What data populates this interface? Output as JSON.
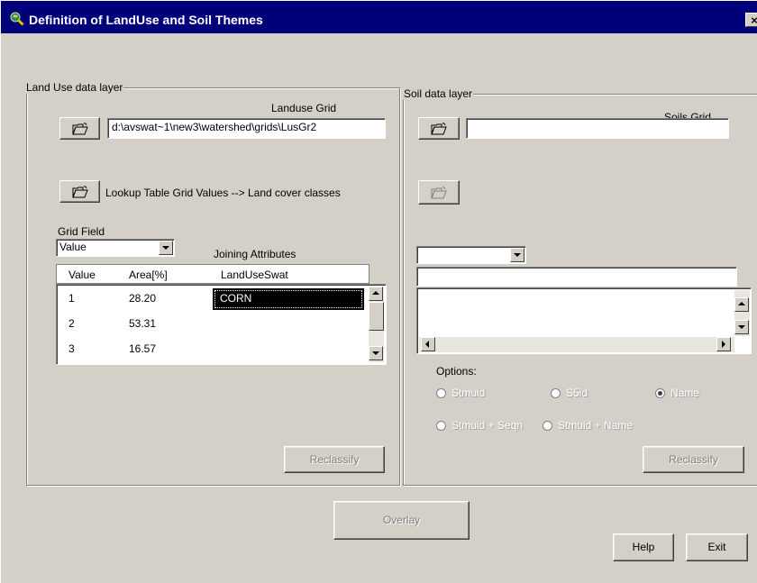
{
  "window": {
    "title": "Definition of LandUse and Soil Themes",
    "close_glyph": "×",
    "title_icon": "globe-magnifier-icon"
  },
  "landuse": {
    "group_label": "Land Use data layer",
    "grid_label": "Landuse Grid",
    "grid_path": "d:\\avswat~1\\new3\\watershed\\grids\\LusGr2",
    "lookup_label": "Lookup Table  Grid Values --> Land cover classes",
    "grid_field_label": "Grid Field",
    "grid_field_value": "Value",
    "joining_label": "Joining Attributes",
    "table": {
      "columns": [
        "Value",
        "Area[%]",
        "LandUseSwat"
      ],
      "rows": [
        {
          "value": "1",
          "area": "28.20",
          "landuse": "CORN"
        },
        {
          "value": "2",
          "area": "53.31",
          "landuse": ""
        },
        {
          "value": "3",
          "area": "16.57",
          "landuse": ""
        }
      ]
    },
    "reclassify_label": "Reclassify"
  },
  "soil": {
    "group_label": "Soil data layer",
    "grid_label": "Soils Grid",
    "grid_path": "",
    "options_label": "Options:",
    "options": [
      {
        "label": "Stmuid",
        "selected": false
      },
      {
        "label": "S5id",
        "selected": false
      },
      {
        "label": "Name",
        "selected": true
      },
      {
        "label": "Stmuid + Seqn",
        "selected": false
      },
      {
        "label": "Stmuid + Name",
        "selected": false
      }
    ],
    "reclassify_label": "Reclassify"
  },
  "footer": {
    "overlay_label": "Overlay",
    "help_label": "Help",
    "exit_label": "Exit"
  },
  "colors": {
    "titlebar": "#00007b",
    "face": "#d4d0c8",
    "selection": "#000000"
  }
}
